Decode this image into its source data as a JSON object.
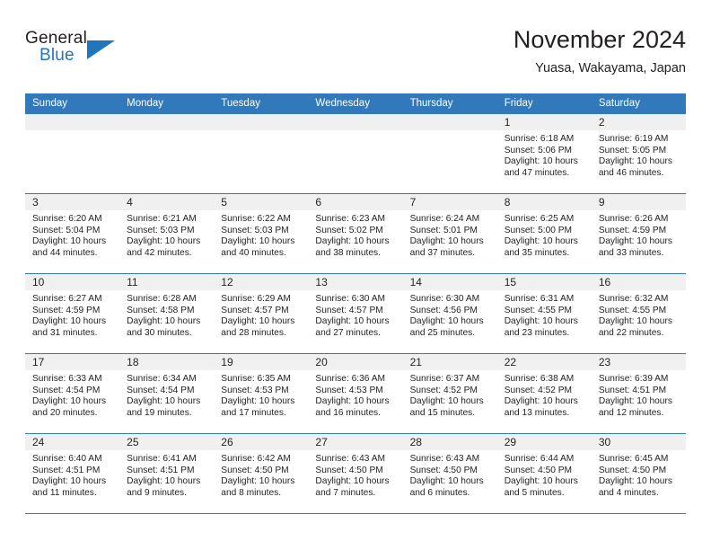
{
  "brand": {
    "word_general": "General",
    "word_blue": "Blue",
    "accent_color": "#1f76bc"
  },
  "header": {
    "month_title": "November 2024",
    "location": "Yuasa, Wakayama, Japan"
  },
  "calendar": {
    "header_bg": "#3179bb",
    "weekdays": [
      "Sunday",
      "Monday",
      "Tuesday",
      "Wednesday",
      "Thursday",
      "Friday",
      "Saturday"
    ],
    "weeks": [
      [
        {
          "day": "",
          "sunrise": "",
          "sunset": "",
          "daylight_line1": "",
          "daylight_line2": ""
        },
        {
          "day": "",
          "sunrise": "",
          "sunset": "",
          "daylight_line1": "",
          "daylight_line2": ""
        },
        {
          "day": "",
          "sunrise": "",
          "sunset": "",
          "daylight_line1": "",
          "daylight_line2": ""
        },
        {
          "day": "",
          "sunrise": "",
          "sunset": "",
          "daylight_line1": "",
          "daylight_line2": ""
        },
        {
          "day": "",
          "sunrise": "",
          "sunset": "",
          "daylight_line1": "",
          "daylight_line2": ""
        },
        {
          "day": "1",
          "sunrise": "Sunrise: 6:18 AM",
          "sunset": "Sunset: 5:06 PM",
          "daylight_line1": "Daylight: 10 hours",
          "daylight_line2": "and 47 minutes."
        },
        {
          "day": "2",
          "sunrise": "Sunrise: 6:19 AM",
          "sunset": "Sunset: 5:05 PM",
          "daylight_line1": "Daylight: 10 hours",
          "daylight_line2": "and 46 minutes."
        }
      ],
      [
        {
          "day": "3",
          "sunrise": "Sunrise: 6:20 AM",
          "sunset": "Sunset: 5:04 PM",
          "daylight_line1": "Daylight: 10 hours",
          "daylight_line2": "and 44 minutes."
        },
        {
          "day": "4",
          "sunrise": "Sunrise: 6:21 AM",
          "sunset": "Sunset: 5:03 PM",
          "daylight_line1": "Daylight: 10 hours",
          "daylight_line2": "and 42 minutes."
        },
        {
          "day": "5",
          "sunrise": "Sunrise: 6:22 AM",
          "sunset": "Sunset: 5:03 PM",
          "daylight_line1": "Daylight: 10 hours",
          "daylight_line2": "and 40 minutes."
        },
        {
          "day": "6",
          "sunrise": "Sunrise: 6:23 AM",
          "sunset": "Sunset: 5:02 PM",
          "daylight_line1": "Daylight: 10 hours",
          "daylight_line2": "and 38 minutes."
        },
        {
          "day": "7",
          "sunrise": "Sunrise: 6:24 AM",
          "sunset": "Sunset: 5:01 PM",
          "daylight_line1": "Daylight: 10 hours",
          "daylight_line2": "and 37 minutes."
        },
        {
          "day": "8",
          "sunrise": "Sunrise: 6:25 AM",
          "sunset": "Sunset: 5:00 PM",
          "daylight_line1": "Daylight: 10 hours",
          "daylight_line2": "and 35 minutes."
        },
        {
          "day": "9",
          "sunrise": "Sunrise: 6:26 AM",
          "sunset": "Sunset: 4:59 PM",
          "daylight_line1": "Daylight: 10 hours",
          "daylight_line2": "and 33 minutes."
        }
      ],
      [
        {
          "day": "10",
          "sunrise": "Sunrise: 6:27 AM",
          "sunset": "Sunset: 4:59 PM",
          "daylight_line1": "Daylight: 10 hours",
          "daylight_line2": "and 31 minutes."
        },
        {
          "day": "11",
          "sunrise": "Sunrise: 6:28 AM",
          "sunset": "Sunset: 4:58 PM",
          "daylight_line1": "Daylight: 10 hours",
          "daylight_line2": "and 30 minutes."
        },
        {
          "day": "12",
          "sunrise": "Sunrise: 6:29 AM",
          "sunset": "Sunset: 4:57 PM",
          "daylight_line1": "Daylight: 10 hours",
          "daylight_line2": "and 28 minutes."
        },
        {
          "day": "13",
          "sunrise": "Sunrise: 6:30 AM",
          "sunset": "Sunset: 4:57 PM",
          "daylight_line1": "Daylight: 10 hours",
          "daylight_line2": "and 27 minutes."
        },
        {
          "day": "14",
          "sunrise": "Sunrise: 6:30 AM",
          "sunset": "Sunset: 4:56 PM",
          "daylight_line1": "Daylight: 10 hours",
          "daylight_line2": "and 25 minutes."
        },
        {
          "day": "15",
          "sunrise": "Sunrise: 6:31 AM",
          "sunset": "Sunset: 4:55 PM",
          "daylight_line1": "Daylight: 10 hours",
          "daylight_line2": "and 23 minutes."
        },
        {
          "day": "16",
          "sunrise": "Sunrise: 6:32 AM",
          "sunset": "Sunset: 4:55 PM",
          "daylight_line1": "Daylight: 10 hours",
          "daylight_line2": "and 22 minutes."
        }
      ],
      [
        {
          "day": "17",
          "sunrise": "Sunrise: 6:33 AM",
          "sunset": "Sunset: 4:54 PM",
          "daylight_line1": "Daylight: 10 hours",
          "daylight_line2": "and 20 minutes."
        },
        {
          "day": "18",
          "sunrise": "Sunrise: 6:34 AM",
          "sunset": "Sunset: 4:54 PM",
          "daylight_line1": "Daylight: 10 hours",
          "daylight_line2": "and 19 minutes."
        },
        {
          "day": "19",
          "sunrise": "Sunrise: 6:35 AM",
          "sunset": "Sunset: 4:53 PM",
          "daylight_line1": "Daylight: 10 hours",
          "daylight_line2": "and 17 minutes."
        },
        {
          "day": "20",
          "sunrise": "Sunrise: 6:36 AM",
          "sunset": "Sunset: 4:53 PM",
          "daylight_line1": "Daylight: 10 hours",
          "daylight_line2": "and 16 minutes."
        },
        {
          "day": "21",
          "sunrise": "Sunrise: 6:37 AM",
          "sunset": "Sunset: 4:52 PM",
          "daylight_line1": "Daylight: 10 hours",
          "daylight_line2": "and 15 minutes."
        },
        {
          "day": "22",
          "sunrise": "Sunrise: 6:38 AM",
          "sunset": "Sunset: 4:52 PM",
          "daylight_line1": "Daylight: 10 hours",
          "daylight_line2": "and 13 minutes."
        },
        {
          "day": "23",
          "sunrise": "Sunrise: 6:39 AM",
          "sunset": "Sunset: 4:51 PM",
          "daylight_line1": "Daylight: 10 hours",
          "daylight_line2": "and 12 minutes."
        }
      ],
      [
        {
          "day": "24",
          "sunrise": "Sunrise: 6:40 AM",
          "sunset": "Sunset: 4:51 PM",
          "daylight_line1": "Daylight: 10 hours",
          "daylight_line2": "and 11 minutes."
        },
        {
          "day": "25",
          "sunrise": "Sunrise: 6:41 AM",
          "sunset": "Sunset: 4:51 PM",
          "daylight_line1": "Daylight: 10 hours",
          "daylight_line2": "and 9 minutes."
        },
        {
          "day": "26",
          "sunrise": "Sunrise: 6:42 AM",
          "sunset": "Sunset: 4:50 PM",
          "daylight_line1": "Daylight: 10 hours",
          "daylight_line2": "and 8 minutes."
        },
        {
          "day": "27",
          "sunrise": "Sunrise: 6:43 AM",
          "sunset": "Sunset: 4:50 PM",
          "daylight_line1": "Daylight: 10 hours",
          "daylight_line2": "and 7 minutes."
        },
        {
          "day": "28",
          "sunrise": "Sunrise: 6:43 AM",
          "sunset": "Sunset: 4:50 PM",
          "daylight_line1": "Daylight: 10 hours",
          "daylight_line2": "and 6 minutes."
        },
        {
          "day": "29",
          "sunrise": "Sunrise: 6:44 AM",
          "sunset": "Sunset: 4:50 PM",
          "daylight_line1": "Daylight: 10 hours",
          "daylight_line2": "and 5 minutes."
        },
        {
          "day": "30",
          "sunrise": "Sunrise: 6:45 AM",
          "sunset": "Sunset: 4:50 PM",
          "daylight_line1": "Daylight: 10 hours",
          "daylight_line2": "and 4 minutes."
        }
      ]
    ]
  }
}
